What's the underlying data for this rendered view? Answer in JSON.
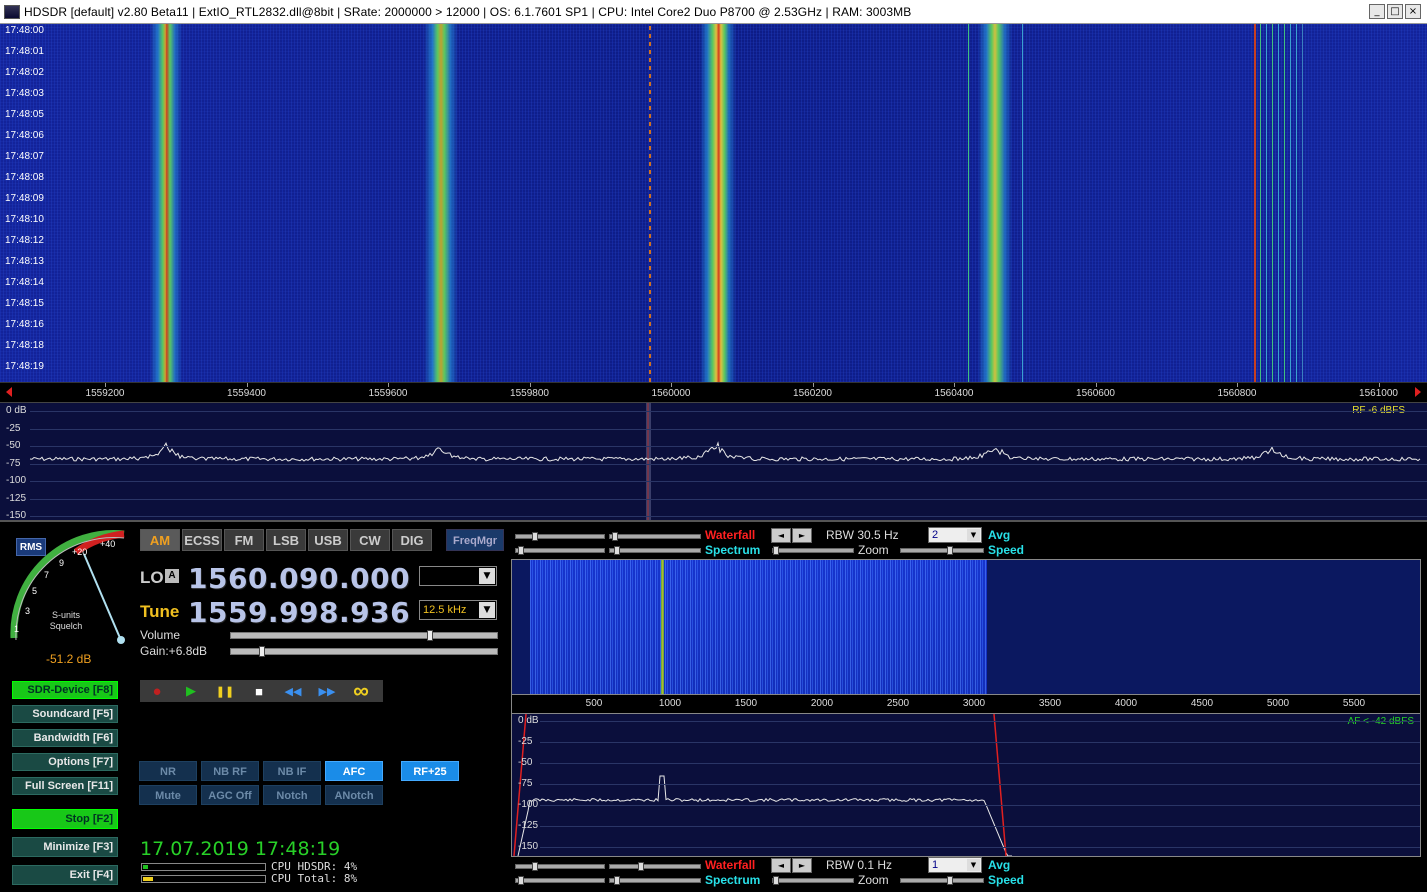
{
  "window": {
    "title": "HDSDR  [default]  v2.80 Beta11  |  ExtIO_RTL2832.dll@8bit  |  SRate: 2000000 > 12000  |  OS: 6.1.7601 SP1  |  CPU: Intel Core2 Duo    P8700  @ 2.53GHz  |  RAM: 3003MB",
    "minimize_glyph": "_",
    "maximize_glyph": "□",
    "close_glyph": "×"
  },
  "waterfall": {
    "timestamps": [
      "17:48:00",
      "17:48:01",
      "17:48:02",
      "17:48:03",
      "17:48:05",
      "17:48:06",
      "17:48:07",
      "17:48:08",
      "17:48:09",
      "17:48:10",
      "17:48:12",
      "17:48:13",
      "17:48:14",
      "17:48:15",
      "17:48:16",
      "17:48:18",
      "17:48:19"
    ]
  },
  "freq_scale": {
    "ticks": [
      "1559200",
      "1559400",
      "1559600",
      "1559800",
      "1560000",
      "1560200",
      "1560400",
      "1560600",
      "1560800",
      "1561000"
    ]
  },
  "spectrum": {
    "db_labels": [
      "0 dB",
      "-25",
      "-50",
      "-75",
      "-100",
      "-125",
      "-150"
    ],
    "rf_label": "RF  -6 dBFS"
  },
  "smeter": {
    "rms_label": "RMS",
    "scale_labels": [
      "1",
      "3",
      "5",
      "7",
      "9",
      "+20",
      "+40"
    ],
    "caption_line1": "S-units",
    "caption_line2": "Squelch",
    "value": "-51.2 dB"
  },
  "left_buttons": {
    "sdr_device": "SDR-Device [F8]",
    "soundcard": "Soundcard  [F5]",
    "bandwidth": "Bandwidth  [F6]",
    "options": "Options   [F7]",
    "fullscreen": "Full Screen  [F11]",
    "stop": "Stop    [F2]",
    "minimize": "Minimize  [F3]",
    "exit": "Exit     [F4]"
  },
  "modes": [
    "AM",
    "ECSS",
    "FM",
    "LSB",
    "USB",
    "CW",
    "DIG"
  ],
  "freqmgr_label": "FreqMgr",
  "lo": {
    "label": "LO",
    "badge": "A",
    "value": "1560.090.000",
    "dropdown_value": ""
  },
  "tune": {
    "label": "Tune",
    "value": "1559.998.936",
    "step": "12.5 kHz"
  },
  "volume_label": "Volume",
  "gain_label": "Gain:+6.8dB",
  "transport": {
    "record": "●",
    "play": "▶",
    "pause": "❚❚",
    "stop": "■",
    "rewind": "◀◀",
    "forward": "▶▶",
    "loop": "∞"
  },
  "dsp": {
    "nr": "NR",
    "nb_rf": "NB RF",
    "nb_if": "NB IF",
    "afc": "AFC",
    "rf25": "RF+25",
    "mute": "Mute",
    "agc": "AGC Off",
    "notch": "Notch",
    "anotch": "ANotch"
  },
  "datetime": "17.07.2019 17:48:19",
  "cpu": {
    "hdsdr_label": "CPU HDSDR:  4%",
    "total_label": "CPU Total:  8%",
    "hdsdr_percent": 4,
    "total_percent": 8
  },
  "rf_controls": {
    "waterfall_label": "Waterfall",
    "spectrum_label": "Spectrum",
    "zoom_label": "Zoom",
    "rbw_label": "RBW 30.5 Hz",
    "avg_value": "2",
    "avg_label": "Avg",
    "speed_label": "Speed",
    "nav_left": "◄",
    "nav_right": "►"
  },
  "af_scale": {
    "ticks": [
      "500",
      "1000",
      "1500",
      "2000",
      "2500",
      "3000",
      "3500",
      "4000",
      "4500",
      "5000",
      "5500"
    ]
  },
  "af_spectrum": {
    "db_labels": [
      "0 dB",
      "-25",
      "-50",
      "-75",
      "-100",
      "-125",
      "-150"
    ],
    "af_label": "AF < -42 dBFS"
  },
  "af_controls": {
    "waterfall_label": "Waterfall",
    "spectrum_label": "Spectrum",
    "zoom_label": "Zoom",
    "rbw_label": "RBW  0.1 Hz",
    "avg_value": "1",
    "avg_label": "Avg",
    "speed_label": "Speed",
    "nav_left": "◄",
    "nav_right": "►"
  },
  "colors": {
    "accent_yellow": "#f0c020",
    "waterfall_red": "#ff2020",
    "spectrum_cyan": "#28e0e8",
    "active_green": "#18c818"
  }
}
